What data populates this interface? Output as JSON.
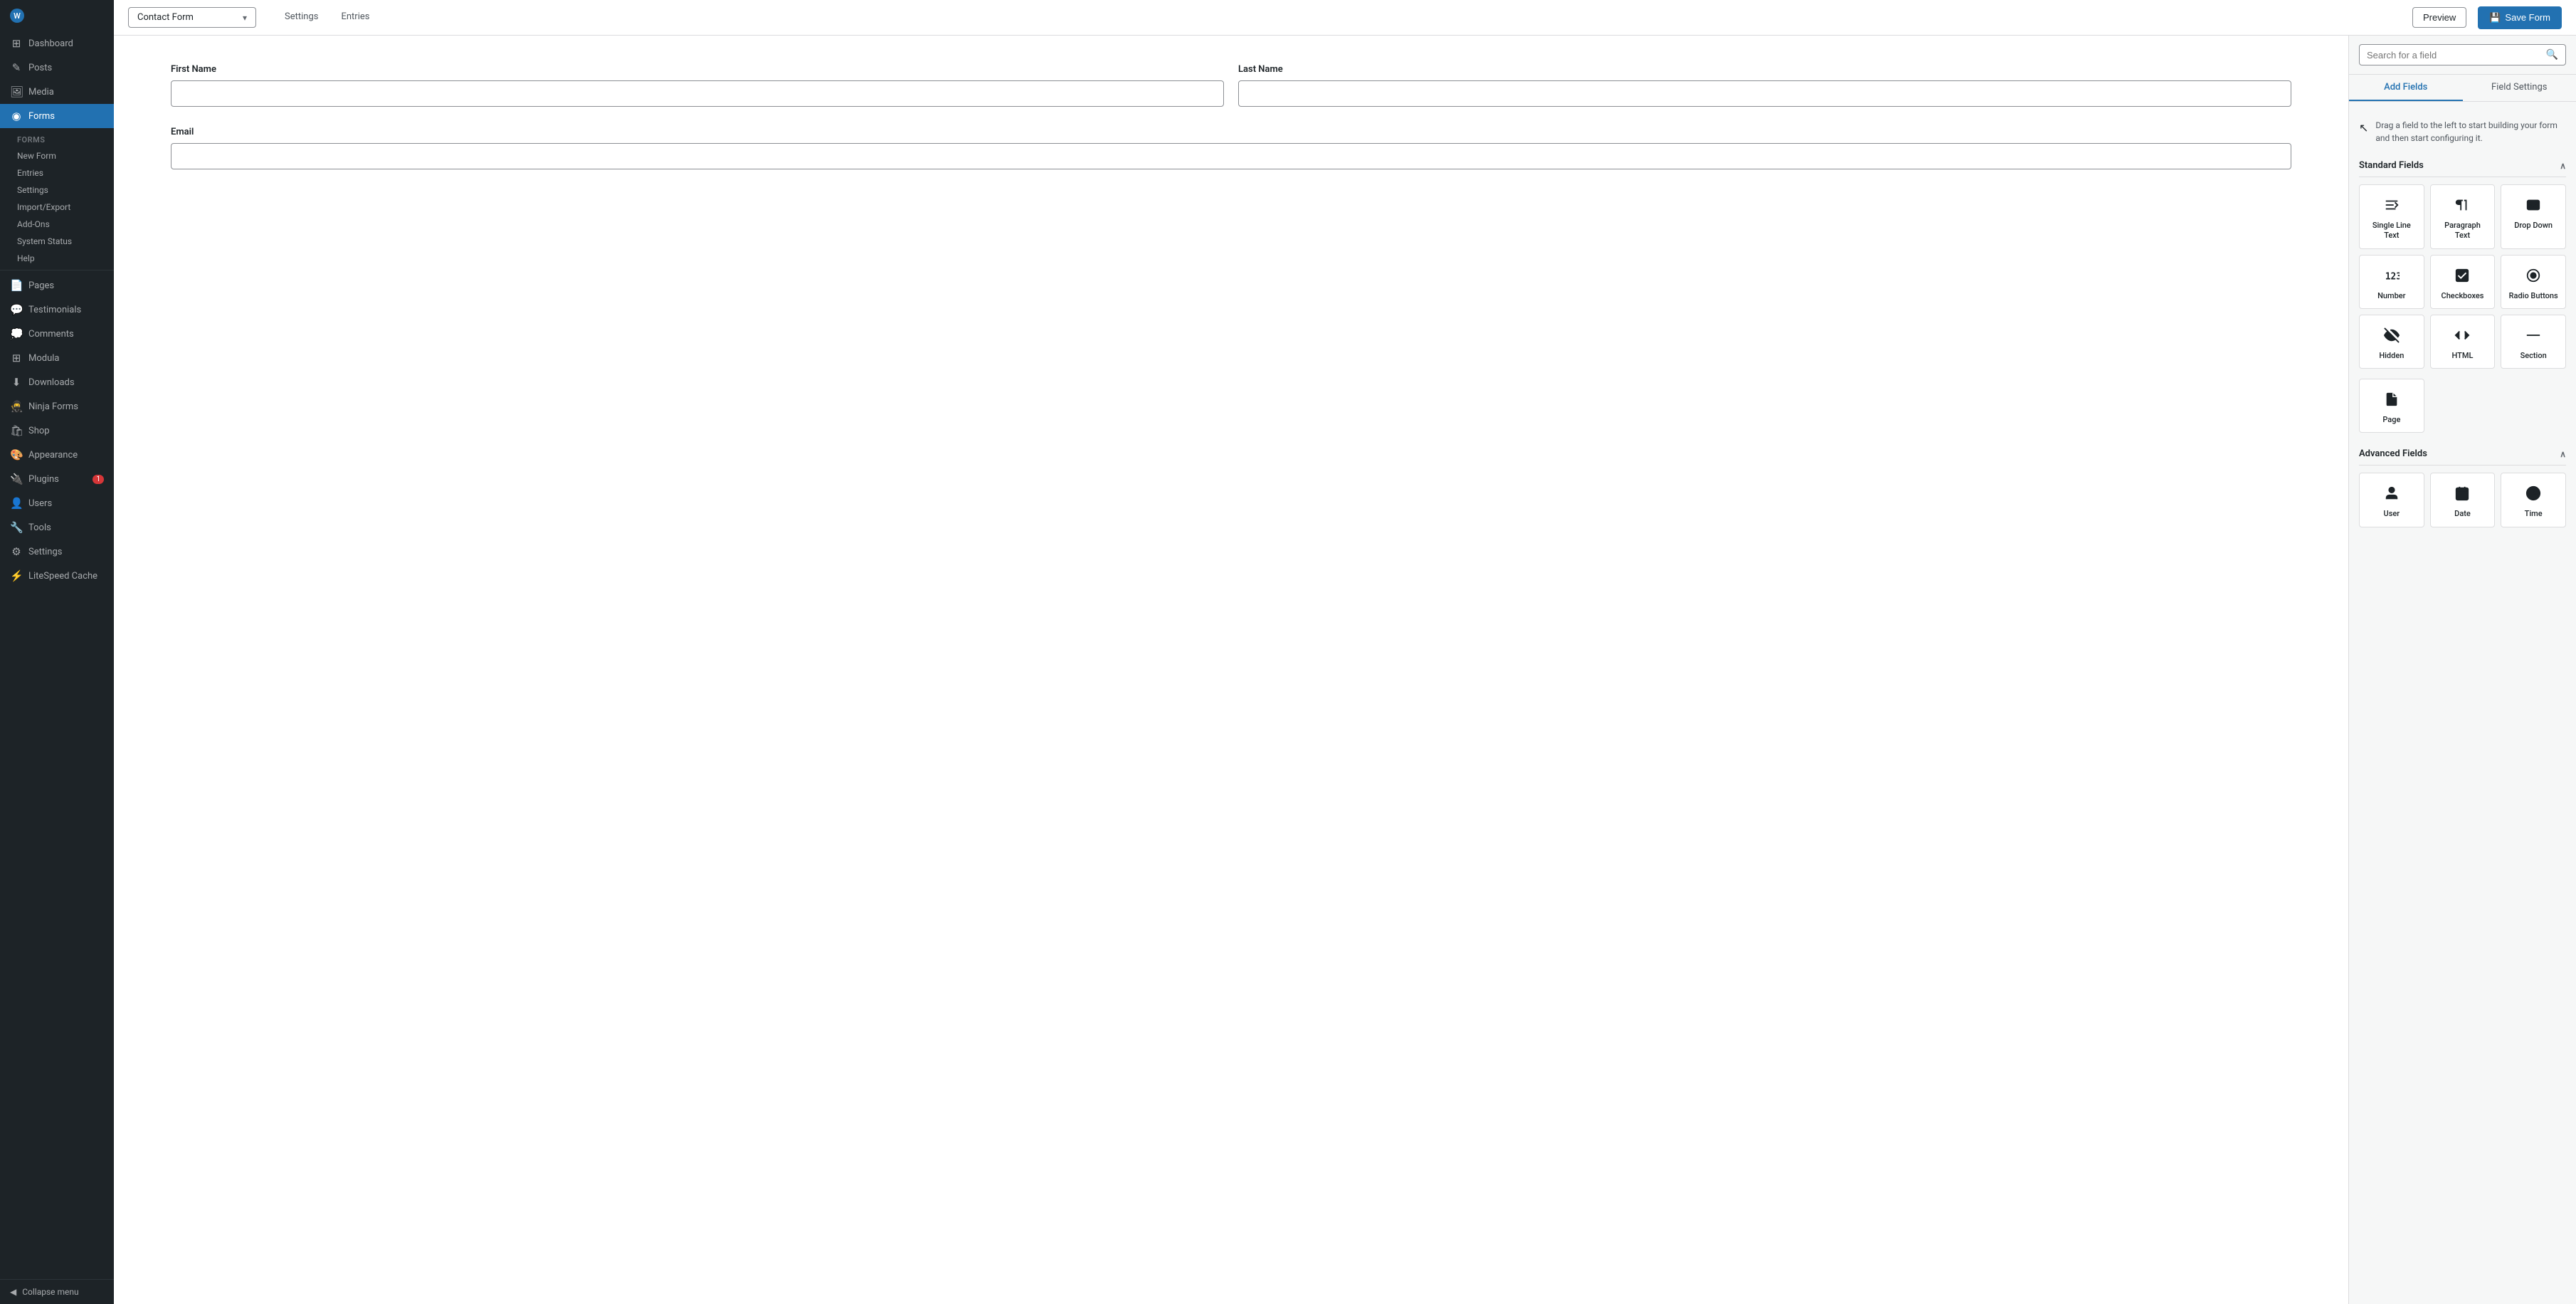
{
  "sidebar": {
    "logo_label": "WordPress",
    "items": [
      {
        "id": "dashboard",
        "label": "Dashboard",
        "icon": "⊞"
      },
      {
        "id": "posts",
        "label": "Posts",
        "icon": "✎"
      },
      {
        "id": "media",
        "label": "Media",
        "icon": "🖼"
      },
      {
        "id": "forms",
        "label": "Forms",
        "icon": "◉",
        "active": true
      },
      {
        "id": "pages",
        "label": "Pages",
        "icon": "📄"
      },
      {
        "id": "testimonials",
        "label": "Testimonials",
        "icon": "💬"
      },
      {
        "id": "comments",
        "label": "Comments",
        "icon": "💭"
      },
      {
        "id": "modula",
        "label": "Modula",
        "icon": "⊞"
      },
      {
        "id": "downloads",
        "label": "Downloads",
        "icon": "⬇"
      },
      {
        "id": "ninja-forms",
        "label": "Ninja Forms",
        "icon": "🥷"
      },
      {
        "id": "shop",
        "label": "Shop",
        "icon": "🛍"
      },
      {
        "id": "appearance",
        "label": "Appearance",
        "icon": "🎨"
      },
      {
        "id": "plugins",
        "label": "Plugins",
        "icon": "🔌",
        "badge": "1"
      },
      {
        "id": "users",
        "label": "Users",
        "icon": "👤"
      },
      {
        "id": "tools",
        "label": "Tools",
        "icon": "🔧"
      },
      {
        "id": "settings",
        "label": "Settings",
        "icon": "⚙"
      },
      {
        "id": "litespeed",
        "label": "LiteSpeed Cache",
        "icon": "⚡"
      }
    ],
    "forms_submenu": [
      {
        "id": "forms-list",
        "label": "Forms"
      },
      {
        "id": "new-form",
        "label": "New Form"
      },
      {
        "id": "entries",
        "label": "Entries"
      },
      {
        "id": "settings-sub",
        "label": "Settings"
      },
      {
        "id": "import-export",
        "label": "Import/Export"
      },
      {
        "id": "add-ons",
        "label": "Add-Ons"
      },
      {
        "id": "system-status",
        "label": "System Status"
      },
      {
        "id": "help",
        "label": "Help"
      }
    ],
    "collapse_label": "Collapse menu"
  },
  "topbar": {
    "form_name": "Contact Form",
    "nav_items": [
      "Settings",
      "Entries"
    ],
    "preview_label": "Preview",
    "save_label": "Save Form",
    "save_icon": "💾"
  },
  "form": {
    "fields": [
      {
        "row": 1,
        "columns": [
          {
            "id": "first-name",
            "label": "First Name",
            "type": "text",
            "placeholder": ""
          },
          {
            "id": "last-name",
            "label": "Last Name",
            "type": "text",
            "placeholder": ""
          }
        ]
      },
      {
        "row": 2,
        "columns": [
          {
            "id": "email",
            "label": "Email",
            "type": "text",
            "placeholder": "",
            "full": true
          }
        ]
      }
    ]
  },
  "right_panel": {
    "search_placeholder": "Search for a field",
    "tabs": [
      "Add Fields",
      "Field Settings"
    ],
    "drag_hint": "Drag a field to the left to start building your form and then start configuring it.",
    "standard_fields_label": "Standard Fields",
    "advanced_fields_label": "Advanced Fields",
    "standard_fields": [
      {
        "id": "single-line-text",
        "label": "Single Line Text",
        "icon": "single-line"
      },
      {
        "id": "paragraph-text",
        "label": "Paragraph Text",
        "icon": "paragraph"
      },
      {
        "id": "drop-down",
        "label": "Drop Down",
        "icon": "dropdown"
      },
      {
        "id": "number",
        "label": "Number",
        "icon": "number"
      },
      {
        "id": "checkboxes",
        "label": "Checkboxes",
        "icon": "checkbox"
      },
      {
        "id": "radio-buttons",
        "label": "Radio Buttons",
        "icon": "radio"
      },
      {
        "id": "hidden",
        "label": "Hidden",
        "icon": "hidden"
      },
      {
        "id": "html",
        "label": "HTML",
        "icon": "html"
      },
      {
        "id": "section",
        "label": "Section",
        "icon": "section"
      },
      {
        "id": "page",
        "label": "Page",
        "icon": "page"
      }
    ],
    "advanced_fields": [
      {
        "id": "user",
        "label": "User",
        "icon": "user"
      },
      {
        "id": "date",
        "label": "Date",
        "icon": "date"
      },
      {
        "id": "time",
        "label": "Time",
        "icon": "time"
      }
    ]
  }
}
